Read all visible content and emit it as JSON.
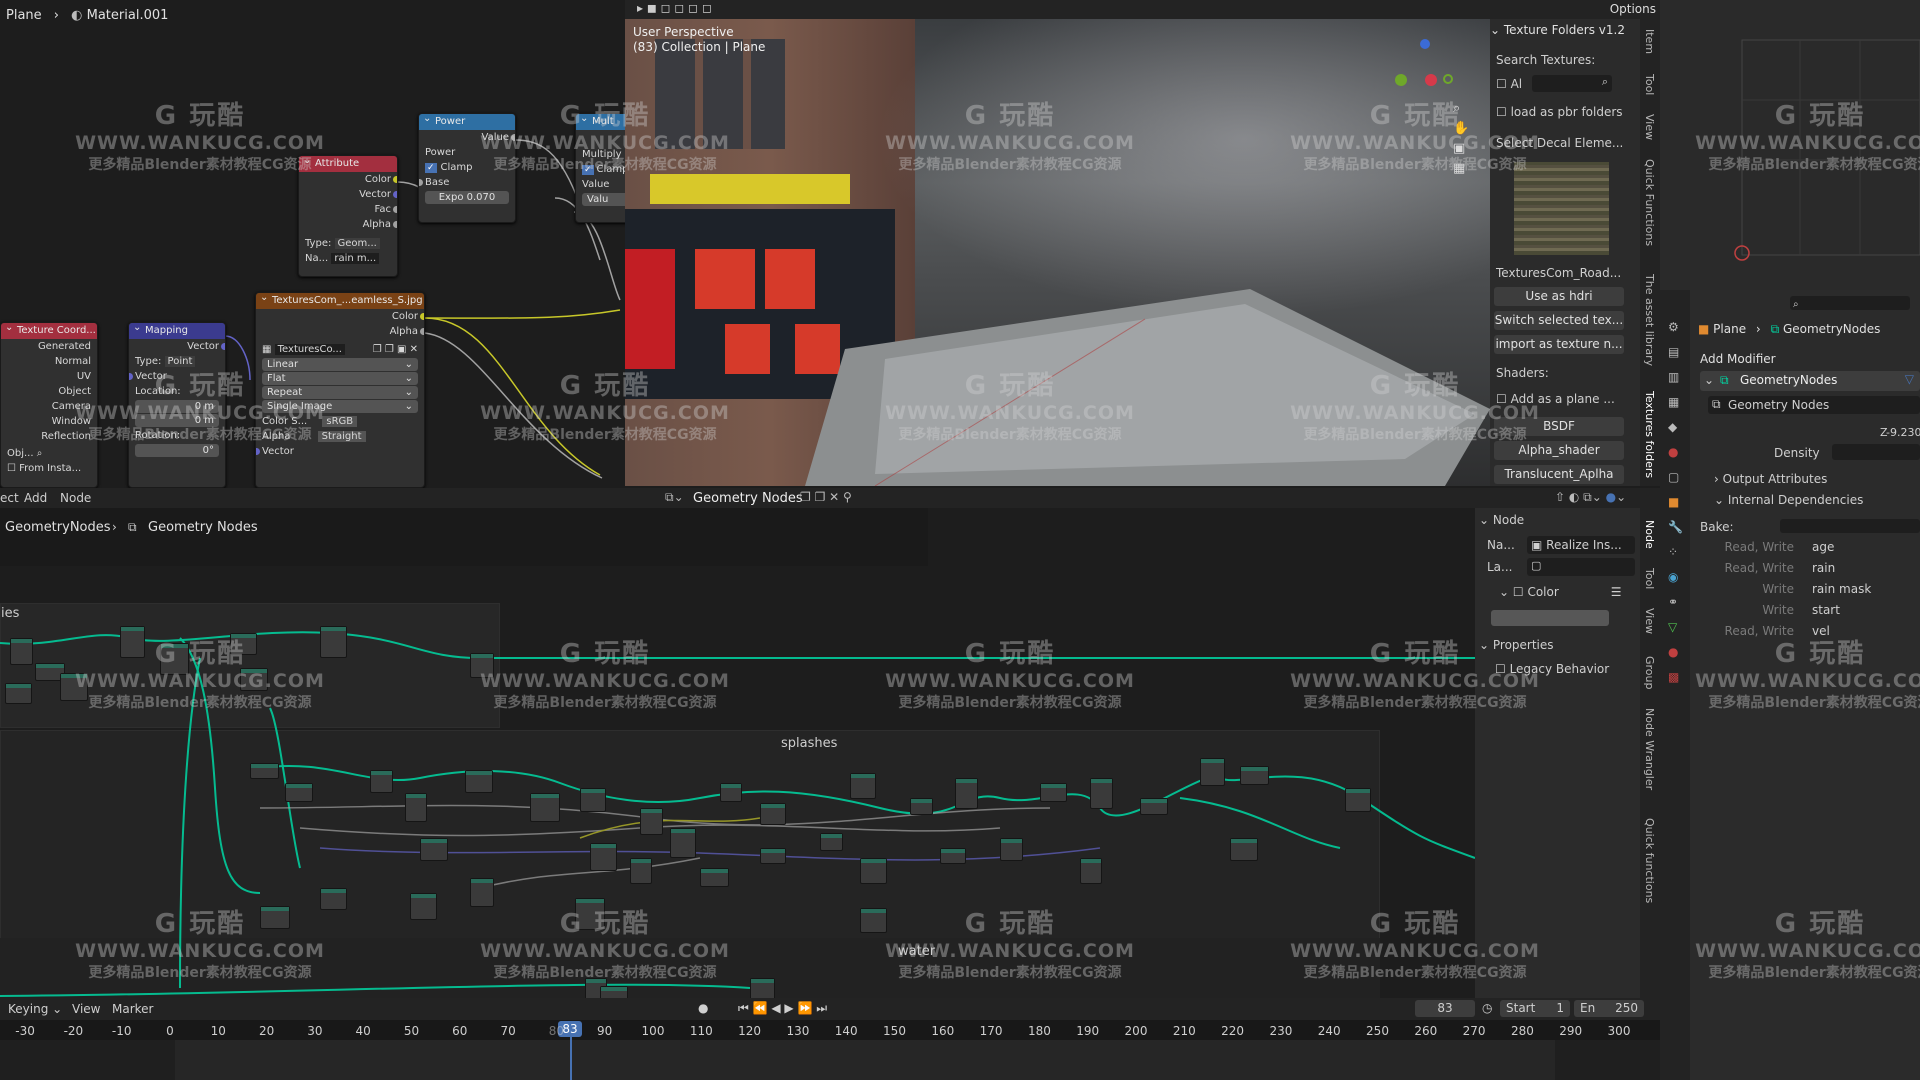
{
  "breadcrumb_top": {
    "object": "Plane",
    "material": "Material.001"
  },
  "shader_nodes": {
    "power": {
      "title": "Power",
      "value_label": "Value",
      "power_label": "Power",
      "clamp_label": "Clamp",
      "base_label": "Base",
      "expo": "Expo  0.070"
    },
    "multiply": {
      "title": "Mult",
      "mult_label": "Multiply",
      "clamp_label": "Clamp",
      "value_label": "Value",
      "value_field": "Valu"
    },
    "attribute": {
      "title": "Attribute",
      "out": [
        "Color",
        "Vector",
        "Fac",
        "Alpha"
      ],
      "type_label": "Type:",
      "type_value": "Geom...",
      "name_label": "Na...",
      "name_value": "rain m..."
    },
    "texcoord": {
      "title": "Texture Coord...",
      "out": [
        "Generated",
        "Normal",
        "UV",
        "Object",
        "Camera",
        "Window",
        "Reflection"
      ],
      "obj_label": "Obj...",
      "from_instancer": "From Insta..."
    },
    "mapping": {
      "title": "Mapping",
      "vector_out": "Vector",
      "type_label": "Type:",
      "type_value": "Point",
      "vector_in": "Vector",
      "location": "Location:",
      "loc_x": "0 m",
      "loc_y": "0 m",
      "rotation": "Rotation:",
      "rot_x": "0°"
    },
    "image_tex": {
      "title": "TexturesCom_...eamless_S.jpg",
      "color": "Color",
      "alpha": "Alpha",
      "image": "TexturesCo...",
      "interp": "Linear",
      "proj": "Flat",
      "ext": "Repeat",
      "source": "Single Image",
      "cs_label": "Color S...",
      "cs_value": "sRGB",
      "alpha_label": "Alpha",
      "alpha_value": "Straight",
      "vector": "Vector"
    }
  },
  "viewport": {
    "line1": "User Perspective",
    "line2": "(83) Collection | Plane",
    "options": "Options"
  },
  "texture_panel": {
    "title": "Texture Folders v1.2",
    "search_label": "Search Textures:",
    "all_label": "Al",
    "pbr_label": "load as pbr folders",
    "decal_label": "Select Decal Eleme...",
    "texture_name": "TexturesCom_Road...",
    "buttons": [
      "Use as hdri",
      "Switch selected tex...",
      "import as texture n..."
    ],
    "shaders_label": "Shaders:",
    "add_plane": "Add as a plane ...",
    "shader_buttons": [
      "BSDF",
      "Alpha_shader",
      "Translucent_Aplha"
    ]
  },
  "right_tabs": [
    "Item",
    "Tool",
    "View",
    "Quick Functions",
    "The asset library",
    "Textures folders"
  ],
  "geo_header": {
    "menus": [
      "ect",
      "Add",
      "Node"
    ],
    "tree": "Geometry Nodes"
  },
  "geo_breadcrumb": {
    "root": "GeometryNodes",
    "tree": "Geometry Nodes"
  },
  "frames": {
    "top": "ies",
    "splashes": "splashes",
    "water": "water"
  },
  "node_panel": {
    "section": "Node",
    "name_label": "Na...",
    "name_value": "Realize Ins...",
    "label_label": "La...",
    "color_label": "Color",
    "properties": "Properties",
    "legacy": "Legacy Behavior"
  },
  "geo_tabs": [
    "Node",
    "Tool",
    "View",
    "Group",
    "Node Wrangler",
    "Quick functions"
  ],
  "props": {
    "breadcrumb_obj": "Plane",
    "breadcrumb_mod": "GeometryNodes",
    "add_modifier": "Add Modifier",
    "modifier_name": "GeometryNodes",
    "tree_name": "Geometry Nodes",
    "z_label": "Z",
    "z_value": "-9.230",
    "density": "Density",
    "output_attrs": "Output Attributes",
    "internal_deps": "Internal Dependencies",
    "bake": "Bake:",
    "deps": [
      {
        "mode": "Read, Write",
        "name": "age"
      },
      {
        "mode": "Read, Write",
        "name": "rain"
      },
      {
        "mode": "Write",
        "name": "rain mask"
      },
      {
        "mode": "Write",
        "name": "start"
      },
      {
        "mode": "Read, Write",
        "name": "vel"
      }
    ]
  },
  "timeline": {
    "menus": [
      "Keying",
      "View",
      "Marker"
    ],
    "current_frame": "83",
    "start_label": "Start",
    "start": "1",
    "end_label": "En",
    "end": "250",
    "ticks": [
      "-30",
      "-20",
      "-10",
      "0",
      "10",
      "20",
      "30",
      "40",
      "50",
      "60",
      "70",
      "80",
      "90",
      "100",
      "110",
      "120",
      "130",
      "140",
      "150",
      "160",
      "170",
      "180",
      "190",
      "200",
      "210",
      "220",
      "230",
      "240",
      "250",
      "260",
      "270",
      "280",
      "290",
      "300"
    ]
  },
  "watermark": {
    "logo": "G 玩酷",
    "url": "WWW.WANKUCG.COM",
    "sub": "更多精品Blender素材教程CG资源"
  },
  "colors": {
    "geometry_socket": "#00d6a3",
    "vector_socket": "#6363c7",
    "color_socket": "#c7c729",
    "float_socket": "#a1a1a1",
    "texture_header": "#7a4215",
    "vector_header": "#3b3b8f",
    "converter_header": "#2e6fa3",
    "input_header": "#a32f3f",
    "accent": "#4772b3",
    "playhead": "#4772b3"
  }
}
